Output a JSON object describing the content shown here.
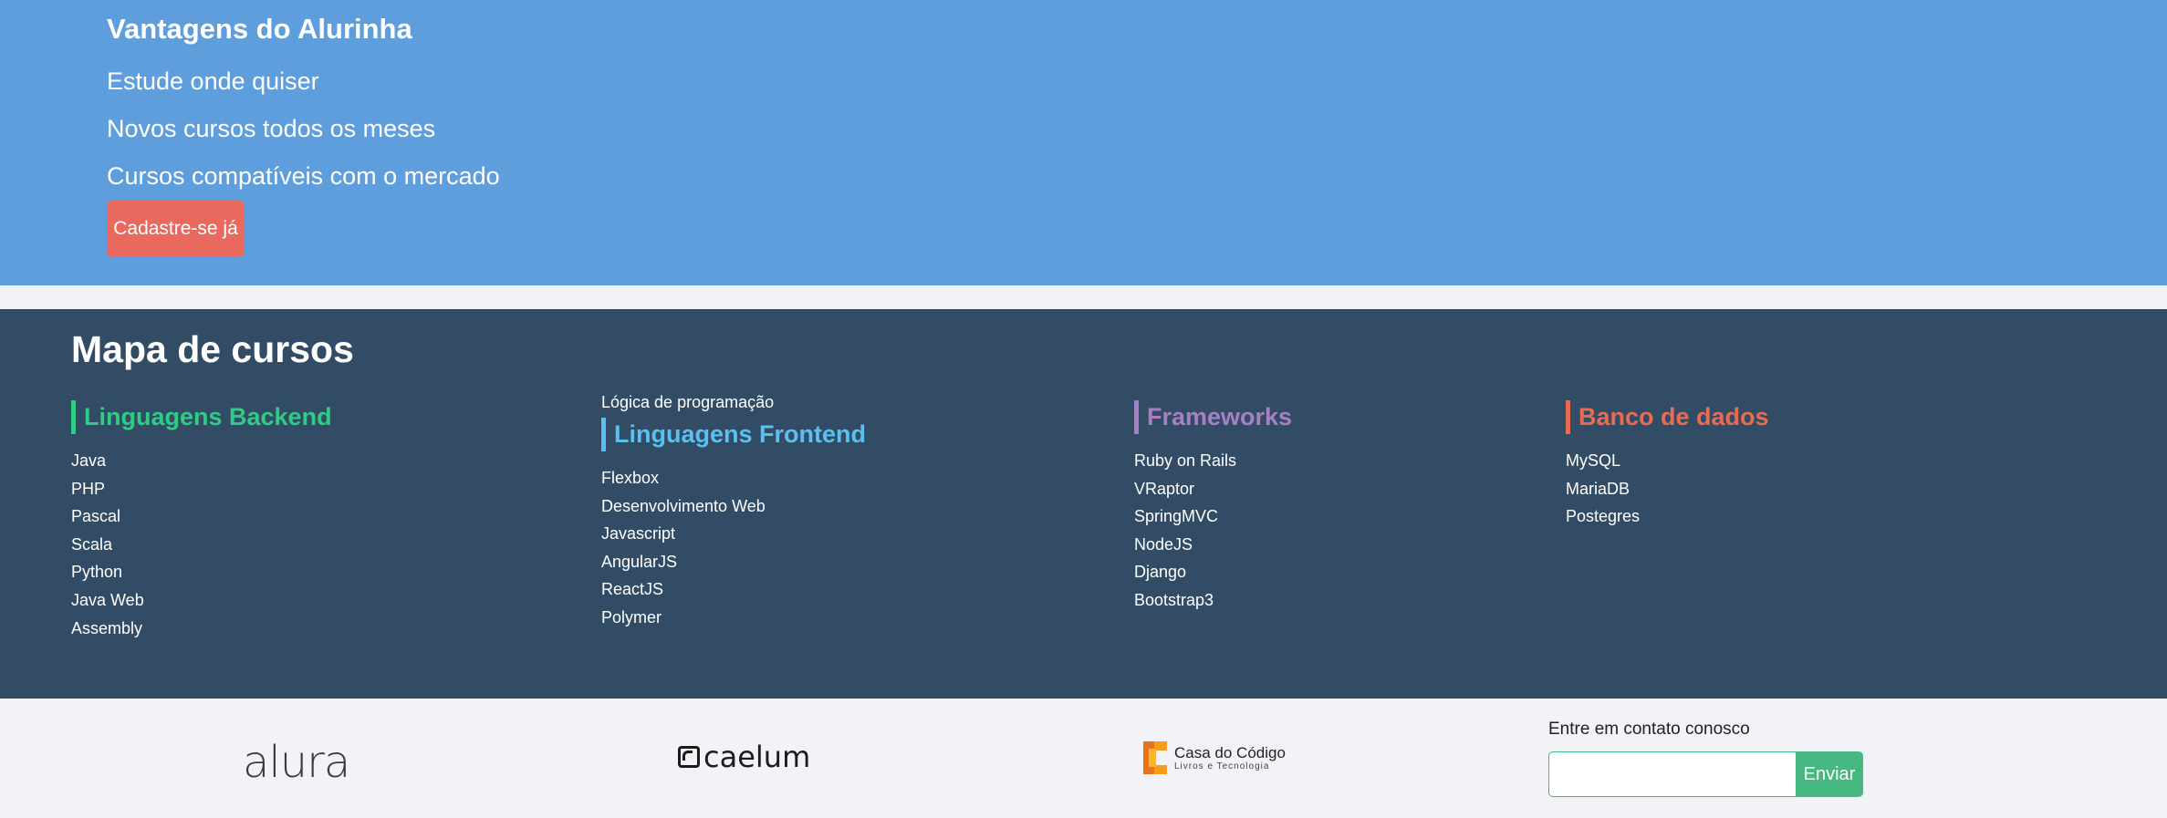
{
  "advantages": {
    "title": "Vantagens do Alurinha",
    "items": [
      "Estude onde quiser",
      "Novos cursos todos os meses",
      "Cursos compatíveis com o mercado"
    ],
    "cta_label": "Cadastre-se já"
  },
  "course_map": {
    "title": "Mapa de cursos",
    "backend": {
      "heading": "Linguagens Backend",
      "color": "#2ecc85",
      "items": [
        "Java",
        "PHP",
        "Pascal",
        "Scala",
        "Python",
        "Java Web",
        "Assembly"
      ]
    },
    "frontend": {
      "top_item": "Lógica de programação",
      "heading": "Linguagens Frontend",
      "color": "#5bc0f0",
      "items": [
        "Flexbox",
        "Desenvolvimento Web",
        "Javascript",
        "AngularJS",
        "ReactJS",
        "Polymer"
      ]
    },
    "frameworks": {
      "heading": "Frameworks",
      "color": "#a680c4",
      "items": [
        "Ruby on Rails",
        "VRaptor",
        "SpringMVC",
        "NodeJS",
        "Django",
        "Bootstrap3"
      ]
    },
    "databases": {
      "heading": "Banco de dados",
      "color": "#ea6a52",
      "items": [
        "MySQL",
        "MariaDB",
        "Postegres"
      ]
    }
  },
  "footer": {
    "logos": {
      "alura": "alura",
      "caelum": "caelum",
      "cdc_main": "Casa do Código",
      "cdc_sub": "Livros e Tecnologia"
    },
    "contact_label": "Entre em contato conosco",
    "contact_placeholder": "",
    "send_label": "Enviar"
  }
}
